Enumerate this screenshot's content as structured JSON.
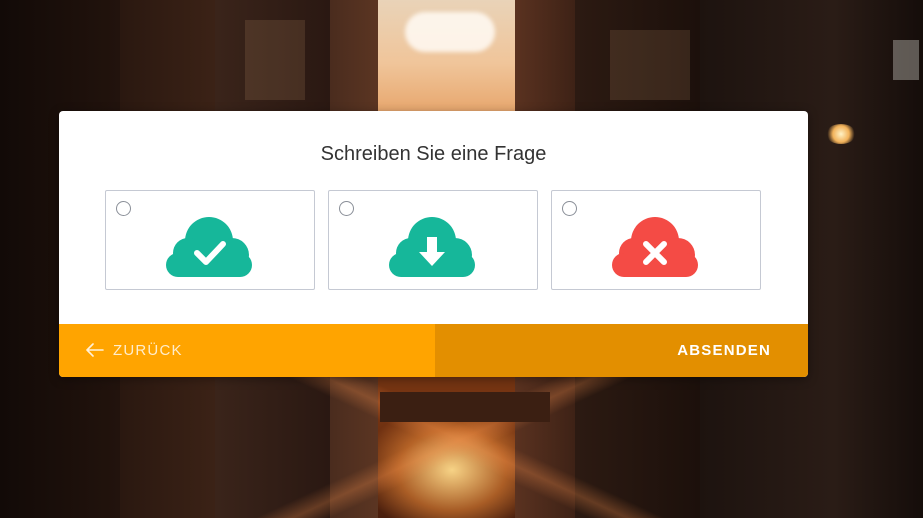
{
  "survey": {
    "question": "Schreiben Sie eine Frage",
    "options": [
      {
        "icon": "cloud-check-icon",
        "color": "#16B79A",
        "selected": false
      },
      {
        "icon": "cloud-download-icon",
        "color": "#16B79A",
        "selected": false
      },
      {
        "icon": "cloud-error-icon",
        "color": "#F44B45",
        "selected": false
      }
    ]
  },
  "footer": {
    "back_label": "ZURÜCK",
    "submit_label": "ABSENDEN"
  },
  "colors": {
    "back_button": "#FFA400",
    "submit_button": "#E38F00",
    "teal": "#16B79A",
    "red": "#F44B45"
  }
}
